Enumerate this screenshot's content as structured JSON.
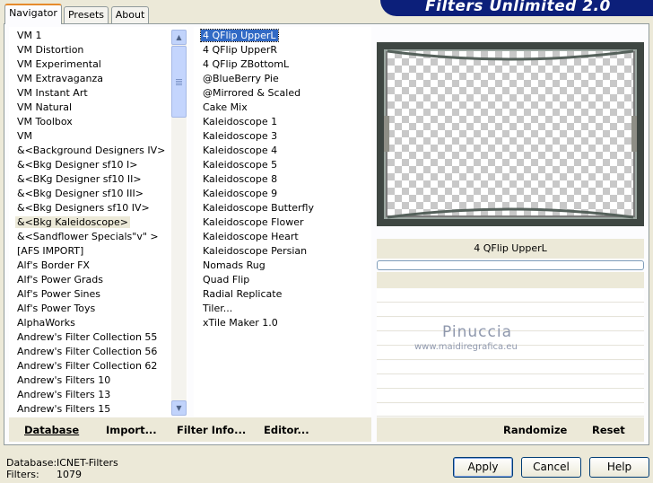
{
  "tabs": [
    {
      "label": "Navigator"
    },
    {
      "label": "Presets"
    },
    {
      "label": "About"
    }
  ],
  "banner": {
    "title": "Filters Unlimited 2.0"
  },
  "categories": {
    "items": [
      "VM 1",
      "VM Distortion",
      "VM Experimental",
      "VM Extravaganza",
      "VM Instant Art",
      "VM Natural",
      "VM Toolbox",
      "VM",
      "&<Background Designers IV>",
      "&<Bkg Designer sf10 I>",
      "&<BKg Designer sf10 II>",
      "&<Bkg Designer sf10 III>",
      "&<Bkg Designers sf10 IV>",
      "&<Bkg Kaleidoscope>",
      "&<Sandflower Specials\"v\" >",
      "[AFS IMPORT]",
      "Alf's Border FX",
      "Alf's Power Grads",
      "Alf's Power Sines",
      "Alf's Power Toys",
      "AlphaWorks",
      "Andrew's Filter Collection 55",
      "Andrew's Filter Collection 56",
      "Andrew's Filter Collection 62",
      "Andrew's Filters 10",
      "Andrew's Filters 13",
      "Andrew's Filters 15"
    ],
    "highlighted": "&<Bkg Kaleidoscope>"
  },
  "filters": {
    "items": [
      "4 QFlip UpperL",
      "4 QFlip UpperR",
      "4 QFlip ZBottomL",
      "@BlueBerry Pie",
      "@Mirrored & Scaled",
      "Cake Mix",
      "Kaleidoscope 1",
      "Kaleidoscope 3",
      "Kaleidoscope 4",
      "Kaleidoscope 5",
      "Kaleidoscope 8",
      "Kaleidoscope 9",
      "Kaleidoscope Butterfly",
      "Kaleidoscope Flower",
      "Kaleidoscope Heart",
      "Kaleidoscope Persian",
      "Nomads Rug",
      "Quad Flip",
      "Radial Replicate",
      "Tiler...",
      "xTile Maker 1.0"
    ],
    "selected": "4 QFlip UpperL"
  },
  "left_buttons": {
    "database": "Database",
    "import": "Import...",
    "filter_info": "Filter Info...",
    "editor": "Editor..."
  },
  "preview": {
    "filter_name": "4 QFlip UpperL",
    "watermark_name": "Pinuccia",
    "watermark_url": "www.maidiregrafica.eu"
  },
  "right_buttons": {
    "randomize": "Randomize",
    "reset": "Reset"
  },
  "status": {
    "database_label": "Database:",
    "database_value": "ICNET-Filters",
    "filters_label": "Filters:",
    "filters_value": "1079"
  },
  "dialog_buttons": {
    "apply": "Apply",
    "cancel": "Cancel",
    "help": "Help"
  },
  "colors": {
    "banner": "#0c1f7a",
    "selection": "#316ac5",
    "tab_accent": "#e68b2c"
  }
}
